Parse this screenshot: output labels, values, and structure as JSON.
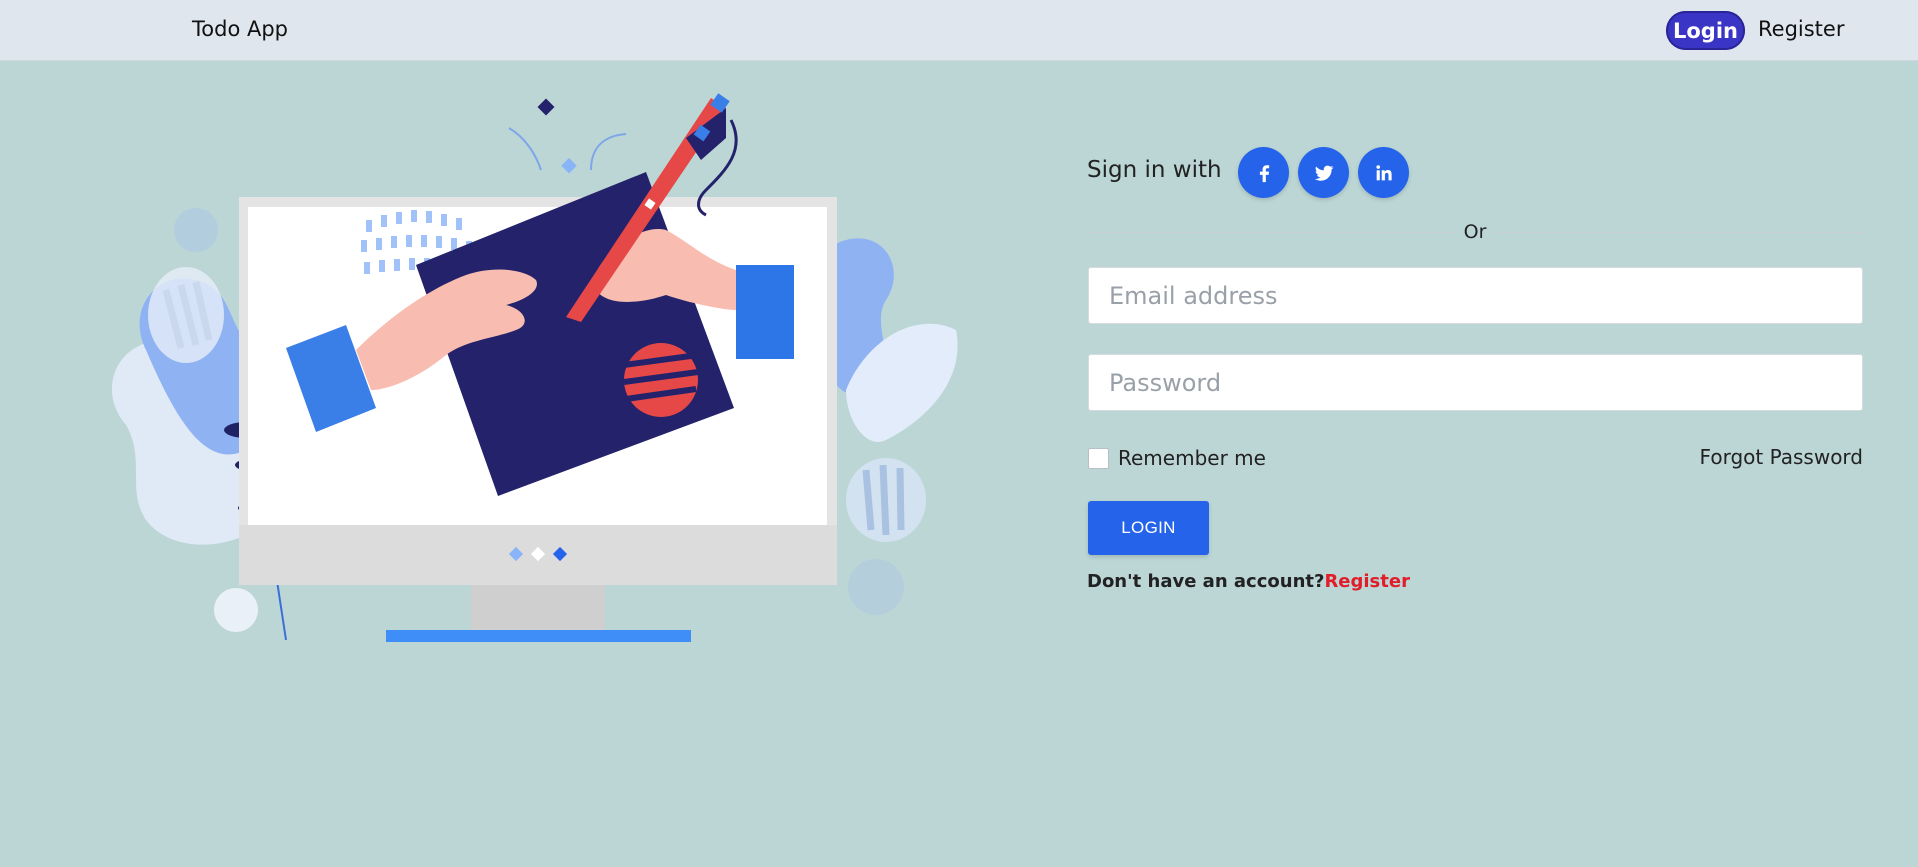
{
  "navbar": {
    "brand": "Todo App",
    "login_label": "Login",
    "register_label": "Register"
  },
  "signin": {
    "label": "Sign in with",
    "social": [
      {
        "name": "facebook-icon",
        "glyph": "f"
      },
      {
        "name": "twitter-icon",
        "glyph": "twitter"
      },
      {
        "name": "linkedin-icon",
        "glyph": "in"
      }
    ]
  },
  "divider": {
    "text": "Or"
  },
  "form": {
    "email_placeholder": "Email address",
    "password_placeholder": "Password",
    "remember_label": "Remember me",
    "forgot_label": "Forgot Password",
    "submit_label": "LOGIN",
    "no_account_text": "Don't have an account?",
    "register_link": "Register"
  },
  "colors": {
    "background": "#bcd6d6",
    "navbar": "#dfe6ee",
    "accent": "#2563eb",
    "nav_active": "#3b35c6",
    "link_red": "#e11d2a"
  }
}
